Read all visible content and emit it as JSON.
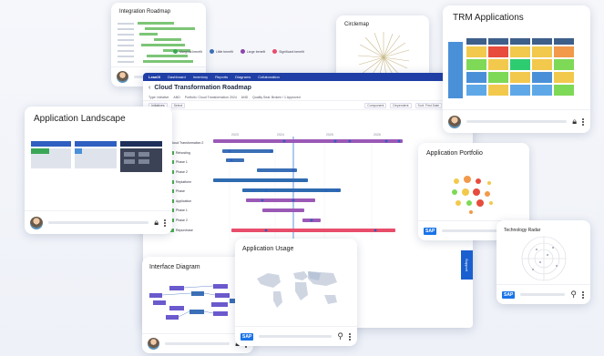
{
  "cards": {
    "integration_roadmap": {
      "title": "Integration Roadmap"
    },
    "circlemap": {
      "title": "Circlemap"
    },
    "trm": {
      "title": "TRM Applications"
    },
    "landscape": {
      "title": "Application Landscape"
    },
    "portfolio": {
      "title": "Application Portfolio"
    },
    "radar": {
      "title": "Technology Radar"
    },
    "usage": {
      "title": "Application Usage"
    },
    "interface": {
      "title": "Interface Diagram"
    }
  },
  "main": {
    "nav": [
      "LeanIX",
      "Dashboard",
      "Inventory",
      "Reports",
      "Diagrams",
      "Collaboration"
    ],
    "title": "Cloud Transformation Roadmap",
    "filters": [
      "Type: Initiative",
      "AND",
      "Portfolio: Cloud Transformation 2024",
      "AND",
      "Quality Seal: Broken / 1 Approved"
    ],
    "toolbar": [
      "Initiatives",
      "Select",
      "Component",
      "Dependent",
      "Sort: First Date",
      "Zoom: Year"
    ],
    "legend": [
      {
        "label": "Marginal benefit",
        "color": "#3aa757"
      },
      {
        "label": "Little benefit",
        "color": "#3b6fb6"
      },
      {
        "label": "Large benefit",
        "color": "#8e44ad"
      },
      {
        "label": "Significant benefit",
        "color": "#e84d6b"
      }
    ],
    "rows": [
      "Cloud Transformation 2",
      "Rehosting",
      "Phase 1",
      "Phase 2",
      "Replatform",
      "Phase",
      "Application",
      "Phase 1",
      "Phase 2",
      "Repurchase"
    ],
    "years": [
      "2023",
      "2024",
      "2025",
      "2026"
    ],
    "support": "Support"
  },
  "colors": {
    "nav": "#1f3fa6",
    "accent": "#1a5fd0"
  }
}
